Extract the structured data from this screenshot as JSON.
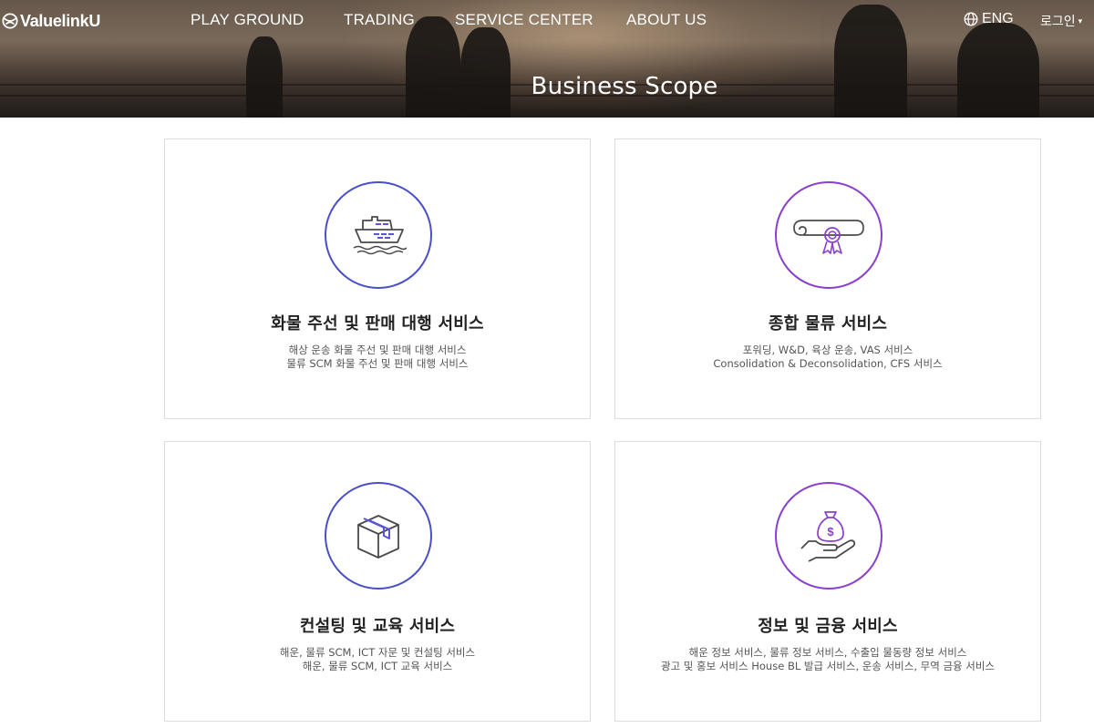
{
  "header": {
    "logo_text": "ValuelinkU",
    "nav": [
      "PLAY GROUND",
      "TRADING",
      "SERVICE CENTER",
      "ABOUT US"
    ],
    "language": "ENG",
    "login": "로그인",
    "page_title": "Business Scope"
  },
  "services": [
    {
      "title": "화물 주선 및 판매 대행 서비스",
      "desc": [
        "해상 운송 화물 주선 및 판매 대행 서비스",
        "물류 SCM 화물 주선 및 판매 대행 서비스"
      ],
      "icon": "ship-icon"
    },
    {
      "title": "종합 물류 서비스",
      "desc": [
        "포워딩, W&D, 육상 운송, VAS 서비스",
        "Consolidation & Deconsolidation, CFS 서비스"
      ],
      "icon": "certificate-icon"
    },
    {
      "title": "컨설팅 및 교육 서비스",
      "desc": [
        "해운, 물류 SCM, ICT 자문 및 컨설팅 서비스",
        "해운, 물류 SCM, ICT 교육 서비스"
      ],
      "icon": "package-icon"
    },
    {
      "title": "정보 및 금융 서비스",
      "desc": [
        "해운 정보 서비스, 물류 정보 서비스, 수출입 물동량 정보 서비스",
        "광고 및 홍보 서비스 House BL 발급 서비스, 운송 서비스, 무역 금융 서비스"
      ],
      "icon": "money-bag-hand-icon"
    }
  ],
  "colors": {
    "circle_blue": "#4a4fc9",
    "circle_purple": "#8a3fcf",
    "icon_gray": "#4a4a4a",
    "accent_blue": "#5a55d6",
    "accent_purple": "#8a3fcf"
  }
}
